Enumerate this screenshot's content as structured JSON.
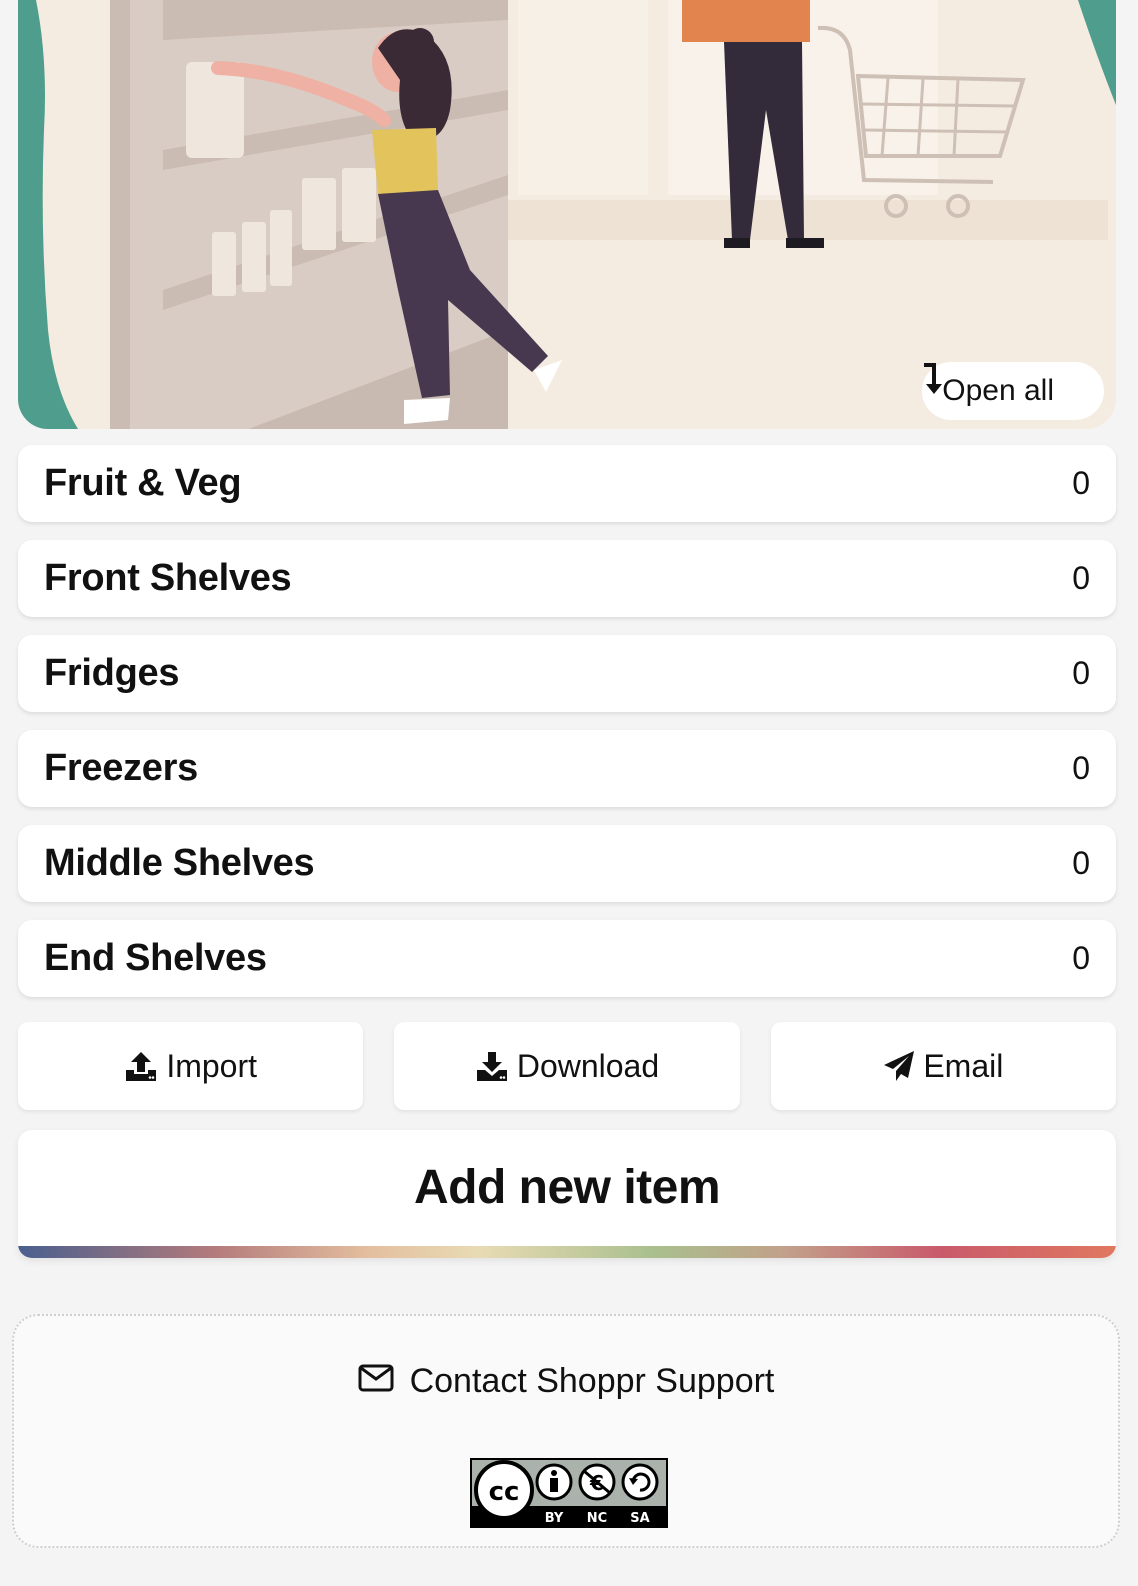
{
  "hero": {
    "image_name": "grocery-store-illustration",
    "open_all_label": "Open all",
    "open_all_icon": "arrow-down-turn-icon"
  },
  "sections": [
    {
      "name": "Fruit & Veg",
      "count": "0"
    },
    {
      "name": "Front Shelves",
      "count": "0"
    },
    {
      "name": "Fridges",
      "count": "0"
    },
    {
      "name": "Freezers",
      "count": "0"
    },
    {
      "name": "Middle Shelves",
      "count": "0"
    },
    {
      "name": "End Shelves",
      "count": "0"
    }
  ],
  "actions": {
    "import_label": "Import",
    "import_icon": "upload-icon",
    "download_label": "Download",
    "download_icon": "download-icon",
    "email_label": "Email",
    "email_icon": "paper-plane-icon"
  },
  "add_item": {
    "label": "Add new item"
  },
  "footer": {
    "contact_label": "Contact Shoppr Support",
    "contact_icon": "envelope-icon",
    "license_badge_text": [
      "BY",
      "NC",
      "SA"
    ]
  },
  "colors": {
    "page_background": "#f4f4f4",
    "card_background": "#ffffff",
    "hero_background": "#f4ece1",
    "hero_accent_teal": "#4f9d8c"
  }
}
